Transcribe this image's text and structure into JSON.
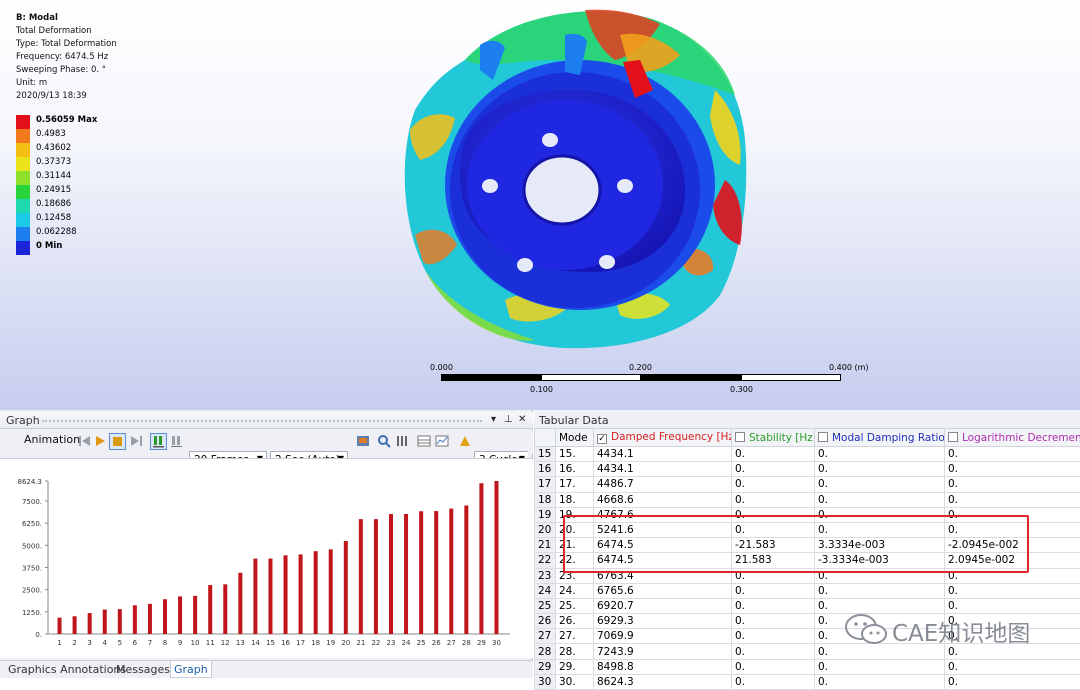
{
  "result_info": {
    "title": "B: Modal",
    "lines": [
      "Total Deformation",
      "Type: Total Deformation",
      "Frequency: 6474.5 Hz",
      "Sweeping Phase: 0. °",
      "Unit: m",
      "2020/9/13 18:39"
    ]
  },
  "legend": [
    {
      "label": "0.56059 Max",
      "color": "#e3101a",
      "bold": true
    },
    {
      "label": "0.4983",
      "color": "#f2781c",
      "bold": false
    },
    {
      "label": "0.43602",
      "color": "#f5bf16",
      "bold": false
    },
    {
      "label": "0.37373",
      "color": "#ece41b",
      "bold": false
    },
    {
      "label": "0.31144",
      "color": "#8fe02a",
      "bold": false
    },
    {
      "label": "0.24915",
      "color": "#27d43b",
      "bold": false
    },
    {
      "label": "0.18686",
      "color": "#1fd8b0",
      "bold": false
    },
    {
      "label": "0.12458",
      "color": "#1cc9e6",
      "bold": false
    },
    {
      "label": "0.062288",
      "color": "#1d7ef0",
      "bold": false
    },
    {
      "label": "0 Min",
      "color": "#1b24d6",
      "bold": true
    }
  ],
  "scale_bar": {
    "top_labels": [
      "0.000",
      "0.200",
      "0.400 (m)"
    ],
    "bottom_labels": [
      "0.100",
      "0.300"
    ]
  },
  "graph_panel": {
    "title": "Graph",
    "header_buttons": [
      "▾",
      "⊥",
      "✕"
    ],
    "animation_label": "Animation",
    "frames_combo": "20 Frames",
    "time_combo": "2 Sec (Auto)",
    "cycles_label": "3 Cycles",
    "tabs": [
      "Graphics Annotations",
      "Messages",
      "Graph"
    ]
  },
  "chart_data": {
    "type": "bar",
    "x": [
      "1",
      "2",
      "3",
      "4",
      "5",
      "6",
      "7",
      "8",
      "9",
      "10",
      "11",
      "12",
      "13",
      "14",
      "15",
      "16",
      "17",
      "18",
      "19",
      "20",
      "21",
      "22",
      "23",
      "24",
      "25",
      "26",
      "27",
      "28",
      "29",
      "30"
    ],
    "values": [
      920,
      1000,
      1180,
      1380,
      1400,
      1620,
      1700,
      1960,
      2120,
      2150,
      2760,
      2800,
      3450,
      4250,
      4250,
      4434.1,
      4486.7,
      4668.6,
      4767.6,
      5241.6,
      6474.5,
      6474.5,
      6763.4,
      6765.6,
      6920.7,
      6929.3,
      7069.9,
      7243.9,
      8498.8,
      8624.3
    ],
    "ytick_labels": [
      "8624.3",
      "7500.",
      "6250.",
      "5000.",
      "3750.",
      "2500.",
      "1250.",
      "0."
    ],
    "ytick_values": [
      8624.3,
      7500,
      6250,
      5000,
      3750,
      2500,
      1250,
      0
    ],
    "ylim": [
      0,
      8624.3
    ],
    "bar_color": "#c0151b"
  },
  "tabular": {
    "title": "Tabular Data",
    "columns": [
      {
        "label": "",
        "color": "#000000",
        "checkbox": false
      },
      {
        "label": "Mode",
        "color": "#000000",
        "checkbox": false
      },
      {
        "label": "Damped Frequency [Hz]",
        "color": "#d42020",
        "checkbox": true,
        "checked": true
      },
      {
        "label": "Stability [Hz]",
        "color": "#2a9a2a",
        "checkbox": true,
        "checked": false
      },
      {
        "label": "Modal Damping Ratio",
        "color": "#1f2fb8",
        "checkbox": true,
        "checked": false
      },
      {
        "label": "Logarithmic Decrement",
        "color": "#b02ab0",
        "checkbox": true,
        "checked": false
      }
    ],
    "rows": [
      [
        "15",
        "15.",
        "4434.1",
        "0.",
        "0.",
        "0."
      ],
      [
        "16",
        "16.",
        "4434.1",
        "0.",
        "0.",
        "0."
      ],
      [
        "17",
        "17.",
        "4486.7",
        "0.",
        "0.",
        "0."
      ],
      [
        "18",
        "18.",
        "4668.6",
        "0.",
        "0.",
        "0."
      ],
      [
        "19",
        "19.",
        "4767.6",
        "0.",
        "0.",
        "0."
      ],
      [
        "20",
        "20.",
        "5241.6",
        "0.",
        "0.",
        "0."
      ],
      [
        "21",
        "21.",
        "6474.5",
        "-21.583",
        "3.3334e-003",
        "-2.0945e-002"
      ],
      [
        "22",
        "22.",
        "6474.5",
        "21.583",
        "-3.3334e-003",
        "2.0945e-002"
      ],
      [
        "23",
        "23.",
        "6763.4",
        "0.",
        "0.",
        "0."
      ],
      [
        "24",
        "24.",
        "6765.6",
        "0.",
        "0.",
        "0."
      ],
      [
        "25",
        "25.",
        "6920.7",
        "0.",
        "0.",
        "0."
      ],
      [
        "26",
        "26.",
        "6929.3",
        "0.",
        "0.",
        "0."
      ],
      [
        "27",
        "27.",
        "7069.9",
        "0.",
        "0.",
        "0."
      ],
      [
        "28",
        "28.",
        "7243.9",
        "0.",
        "0.",
        "0."
      ],
      [
        "29",
        "29.",
        "8498.8",
        "0.",
        "0.",
        "0."
      ],
      [
        "30",
        "30.",
        "8624.3",
        "0.",
        "0.",
        "0."
      ]
    ]
  },
  "watermark": {
    "text": "CAE知识地图"
  }
}
